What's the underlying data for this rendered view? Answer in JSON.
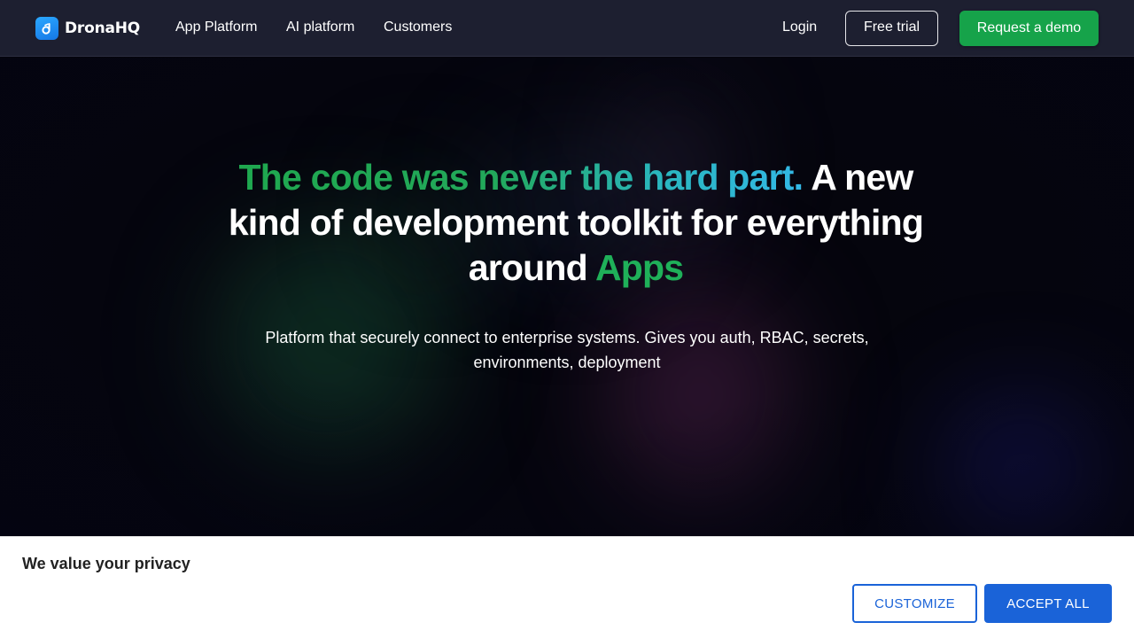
{
  "header": {
    "logo_text": "DronaHQ",
    "logo_icon": "dronahq-logo-icon",
    "nav": {
      "app_platform": "App Platform",
      "ai_platform": "AI platform",
      "customers": "Customers"
    },
    "login": "Login",
    "free_trial": "Free trial",
    "request_demo": "Request a demo"
  },
  "hero": {
    "headline_gradient": "The code was never the hard part.",
    "headline_rest": " A new kind of development toolkit for everything around ",
    "headline_highlight": "Apps",
    "subheadline_line1": "Platform that securely connect to enterprise systems. Gives you auth, RBAC, secrets,",
    "subheadline_line2": "environments, deployment"
  },
  "cookie_banner": {
    "title": "We value your privacy",
    "customize": "CUSTOMIZE",
    "accept_all": "ACCEPT ALL"
  },
  "colors": {
    "nav_background": "#1d1f30",
    "demo_button": "#16a34a",
    "highlight_green": "#1fb059",
    "gradient_start": "#1fa84f",
    "gradient_end": "#33b8e6",
    "cookie_button_blue": "#1a63d8"
  }
}
